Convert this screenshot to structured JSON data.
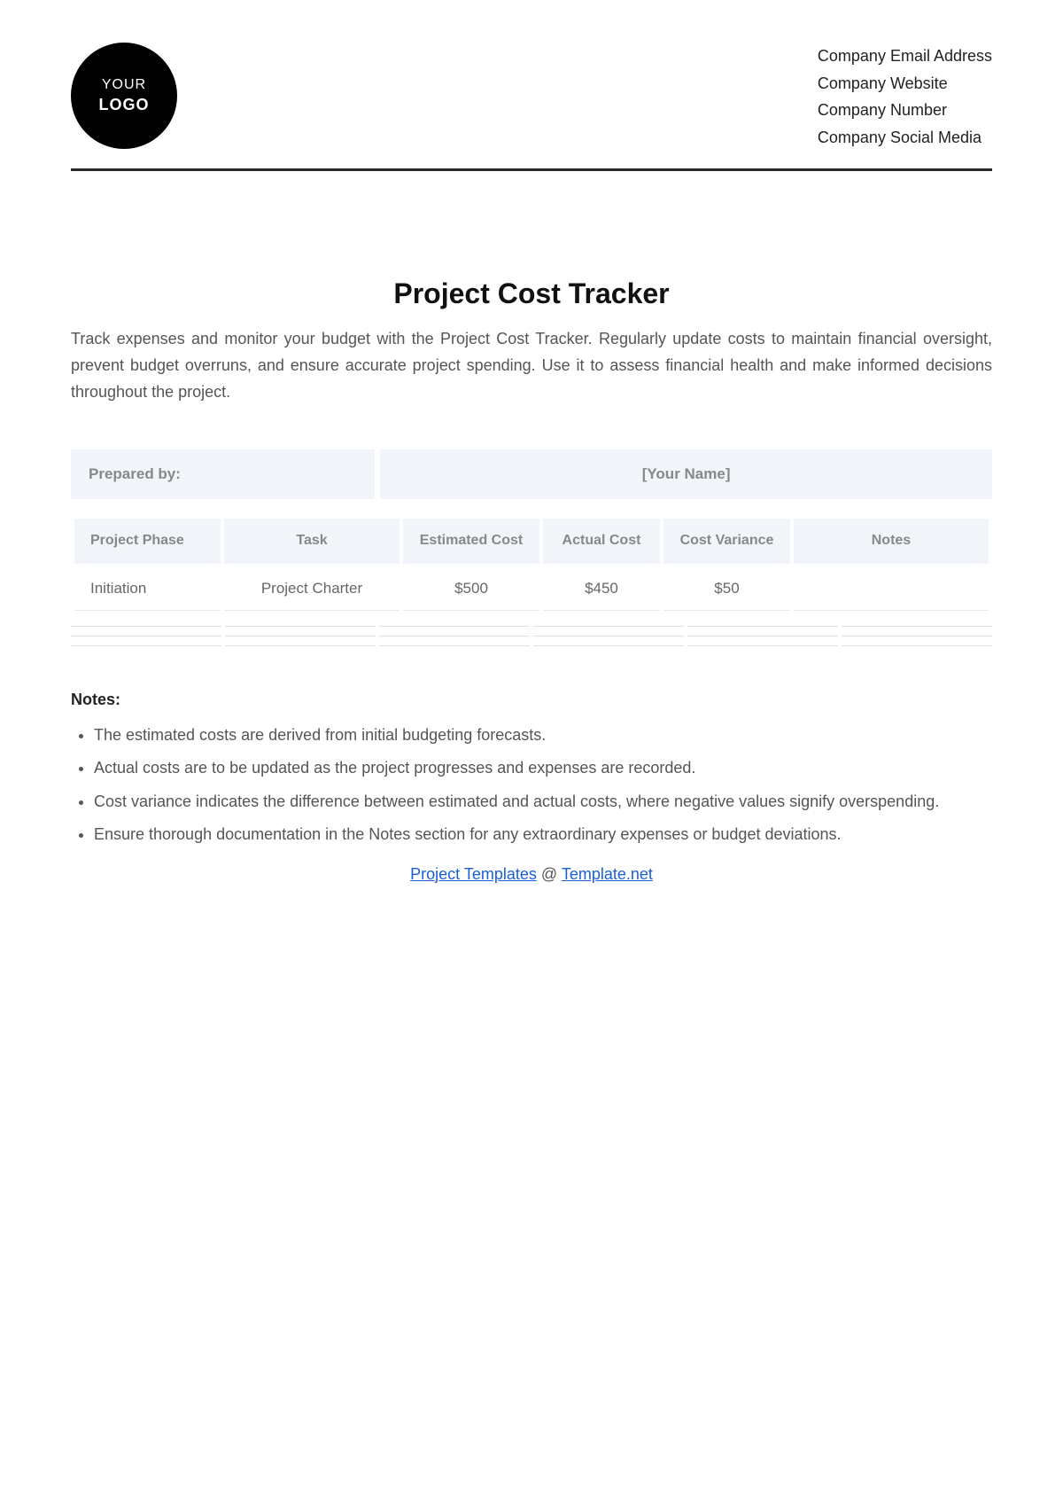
{
  "header": {
    "logo": {
      "line1": "YOUR",
      "line2": "LOGO"
    },
    "company": {
      "email": "Company Email Address",
      "website": "Company Website",
      "number": "Company Number",
      "social": "Company Social Media"
    }
  },
  "title": "Project Cost Tracker",
  "description": "Track expenses and monitor your budget with the Project Cost Tracker. Regularly update costs to maintain financial oversight, prevent budget overruns, and ensure accurate project spending. Use it to assess financial health and make informed decisions throughout the project.",
  "prepared": {
    "label": "Prepared by:",
    "value": "[Your Name]"
  },
  "table": {
    "headers": {
      "phase": "Project Phase",
      "task": "Task",
      "estimated": "Estimated Cost",
      "actual": "Actual Cost",
      "variance": "Cost Variance",
      "notes": "Notes"
    },
    "rows": [
      {
        "phase": "Initiation",
        "task": "Project Charter",
        "estimated": "$500",
        "actual": "$450",
        "variance": "$50",
        "notes": ""
      }
    ]
  },
  "notes": {
    "heading": "Notes:",
    "items": [
      "The estimated costs are derived from initial budgeting forecasts.",
      "Actual costs are to be updated as the project progresses and expenses are recorded.",
      "Cost variance indicates the difference between estimated and actual costs, where negative values signify overspending.",
      "Ensure thorough documentation in the Notes section for any extraordinary expenses or budget deviations."
    ]
  },
  "footer": {
    "link1": "Project Templates",
    "separator": " @ ",
    "link2": "Template.net"
  }
}
